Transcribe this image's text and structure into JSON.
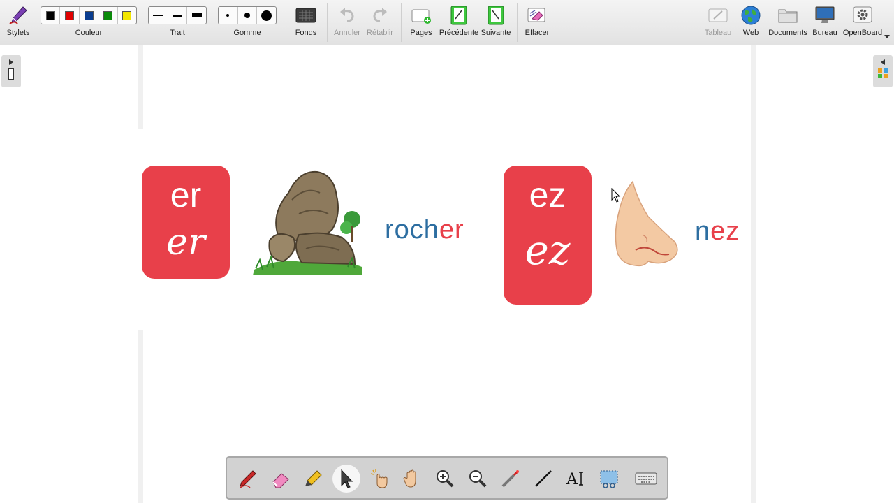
{
  "toolbar": {
    "stylets": "Stylets",
    "couleur": "Couleur",
    "trait": "Trait",
    "gomme": "Gomme",
    "fonds": "Fonds",
    "annuler": "Annuler",
    "retablir": "Rétablir",
    "pages": "Pages",
    "precedente": "Précédente",
    "suivante": "Suivante",
    "effacer": "Effacer",
    "tableau": "Tableau",
    "web": "Web",
    "documents": "Documents",
    "bureau": "Bureau",
    "openboard": "OpenBoard",
    "colors": [
      "#000000",
      "#e00000",
      "#0a3d8f",
      "#0a8a0a",
      "#f2e600"
    ]
  },
  "board": {
    "card1": {
      "print": "er",
      "cursive": "er",
      "word_start": "roch",
      "word_end": "er"
    },
    "card2": {
      "print": "ez",
      "cursive": "ez",
      "word_start": "n",
      "word_end": "ez"
    }
  },
  "palette": {
    "tools": [
      "pen-tool",
      "eraser-tool",
      "marker-tool",
      "selector-tool",
      "interact-tool",
      "hand-tool",
      "zoom-in-tool",
      "zoom-out-tool",
      "laser-pointer-tool",
      "line-tool",
      "text-tool",
      "capture-tool",
      "keyboard-tool"
    ],
    "active": "selector-tool"
  },
  "theme": {
    "tile": "#e8404a",
    "blue_text": "#2d6ea1"
  }
}
